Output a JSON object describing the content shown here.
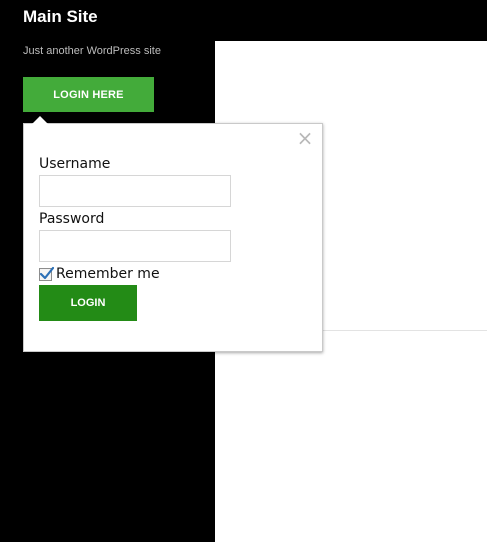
{
  "header": {
    "site_title": "Main Site",
    "tagline": "Just another WordPress site",
    "login_toggle_label": "LOGIN HERE"
  },
  "login_popup": {
    "close_symbol": "×",
    "username_label": "Username",
    "username_value": "",
    "password_label": "Password",
    "password_value": "",
    "remember_label": "Remember me",
    "remember_checked": true,
    "submit_label": "LOGIN",
    "icons": [
      "close-icon",
      "checkmark-icon"
    ]
  },
  "colors": {
    "background": "#000000",
    "content_bg": "#ffffff",
    "login_toggle_green": "#43ab3a",
    "login_submit_green": "#238b16",
    "popup_border": "#c9c9c9",
    "close_icon": "#b8b8b8"
  }
}
